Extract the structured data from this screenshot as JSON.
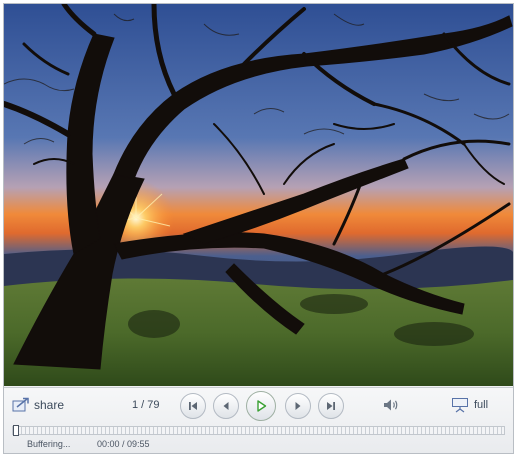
{
  "player": {
    "share_label": "share",
    "counter": "1 / 79",
    "status": "Buffering...",
    "time": "00:00 / 09:55",
    "full_label": "full",
    "progress_fraction": 0
  },
  "icons": {
    "share": "share-icon",
    "first": "skip-to-first-icon",
    "prev": "previous-icon",
    "play": "play-icon",
    "next": "next-icon",
    "last": "skip-to-last-icon",
    "volume": "volume-icon",
    "fullscreen": "fullscreen-icon"
  },
  "colors": {
    "play_icon": "#3aa033",
    "button_icon": "#5c6673",
    "label_text": "#3c4a5c"
  }
}
